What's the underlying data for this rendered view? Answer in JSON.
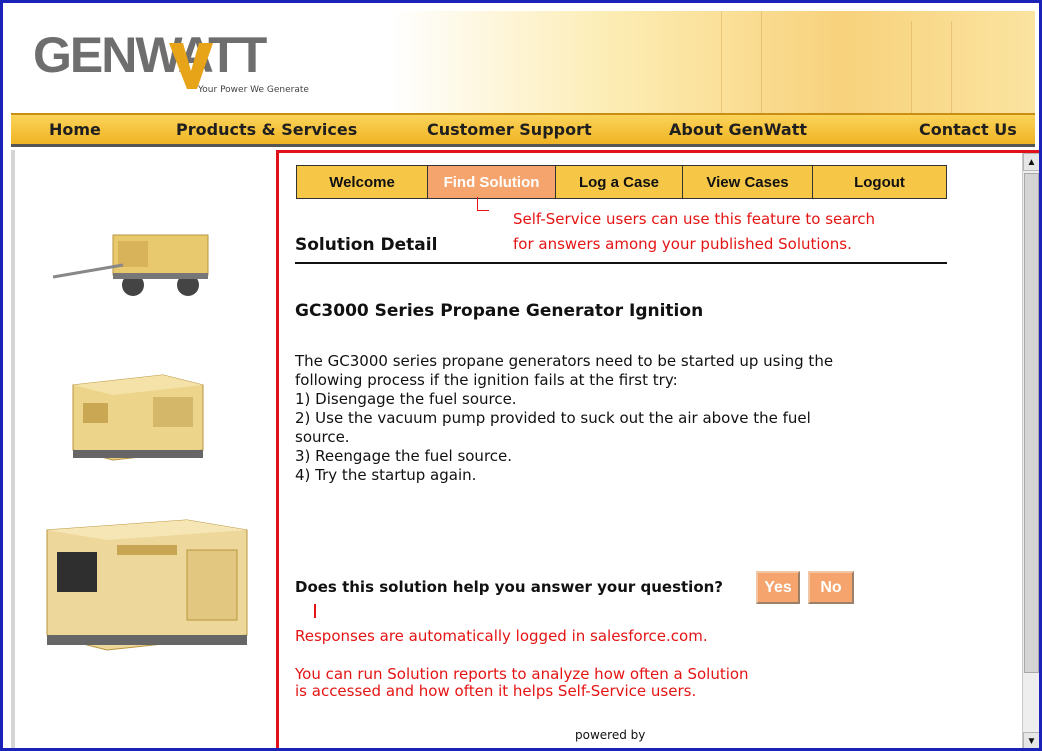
{
  "brand": {
    "logo_text": "GENWATT",
    "tagline": "Your Power We Generate"
  },
  "nav": {
    "home": "Home",
    "products": "Products & Services",
    "support": "Customer Support",
    "about": "About GenWatt",
    "contact": "Contact Us"
  },
  "tabs": {
    "welcome": "Welcome",
    "find_solution": "Find Solution",
    "log_case": "Log a Case",
    "view_cases": "View Cases",
    "logout": "Logout"
  },
  "annotations": {
    "find_solution_line1": "Self-Service users can use this feature to search",
    "find_solution_line2": "for answers among your published Solutions.",
    "responses_logged": "Responses are automatically logged in salesforce.com.",
    "reports_line1": "You can run Solution reports to analyze how often a Solution",
    "reports_line2": "is accessed and how often it helps Self-Service users."
  },
  "page": {
    "section_title": "Solution Detail",
    "solution_title": "GC3000 Series Propane Generator Ignition",
    "body_lines": [
      "The GC3000 series propane generators need to be started up using the",
      "following process if the ignition fails at the first try:",
      "1) Disengage the fuel source.",
      "2) Use the vacuum pump provided to suck out the air above the fuel",
      "source.",
      "3) Reengage the fuel source.",
      "4) Try the startup again."
    ],
    "help_question": "Does this solution help you answer your question?",
    "yes_label": "Yes",
    "no_label": "No",
    "powered_by": "powered by"
  },
  "colors": {
    "frame_border": "#1a22b8",
    "content_border": "#e2101a",
    "tab_bg": "#f6c646",
    "tab_active_bg": "#f5a46d",
    "annotation_red": "#e51414",
    "nav_gold": "#f0b323"
  },
  "icons": {
    "scroll_up": "scroll-up-arrow-icon",
    "scroll_down": "scroll-down-arrow-icon"
  }
}
